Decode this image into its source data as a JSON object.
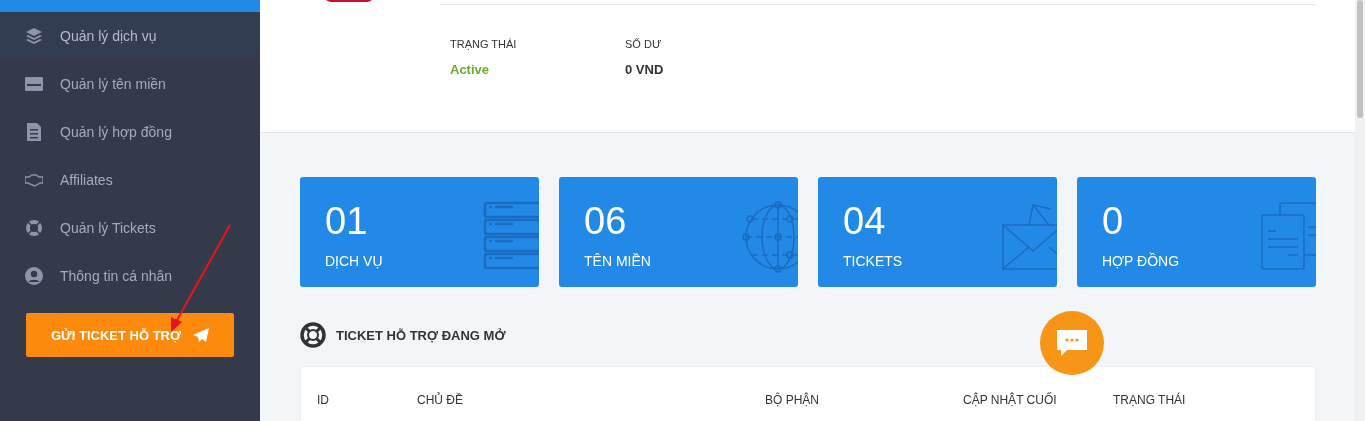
{
  "sidebar": {
    "items": [
      {
        "label": "Quản lý dịch vụ",
        "selected": true
      },
      {
        "label": "Quản lý tên miền",
        "selected": false
      },
      {
        "label": "Quản lý hợp đồng",
        "selected": false
      },
      {
        "label": "Affiliates",
        "selected": false
      },
      {
        "label": "Quản lý Tickets",
        "selected": false
      },
      {
        "label": "Thông tin cá nhân",
        "selected": false
      }
    ],
    "button": {
      "label": "GỬI TICKET HỖ TRỢ"
    }
  },
  "account": {
    "fields": [
      {
        "label": "TRẠNG THÁI",
        "value": "Active",
        "kind": "status"
      },
      {
        "label": "SỐ DƯ",
        "value": "0 VND",
        "kind": "plain"
      }
    ]
  },
  "stats": [
    {
      "count": "01",
      "label": "DỊCH VỤ"
    },
    {
      "count": "06",
      "label": "TÊN MIỀN"
    },
    {
      "count": "04",
      "label": "TICKETS"
    },
    {
      "count": "0",
      "label": "HỢP ĐỒNG"
    }
  ],
  "tickets": {
    "title": "TICKET HỖ TRỢ ĐANG MỞ",
    "columns": [
      "ID",
      "CHỦ ĐỀ",
      "BỘ PHẬN",
      "CẬP NHẬT CUỐI",
      "TRẠNG THÁI"
    ]
  }
}
